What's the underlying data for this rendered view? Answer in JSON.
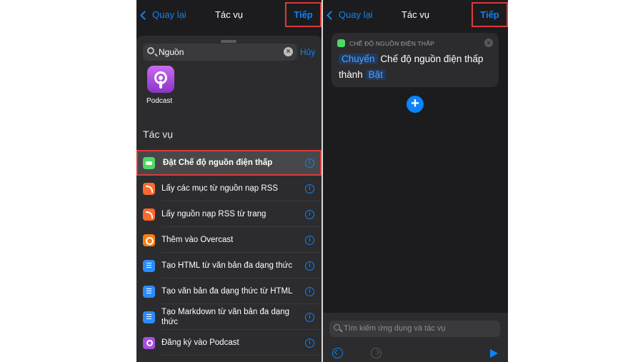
{
  "left": {
    "nav": {
      "back_label": "Quay lại",
      "title": "Tác vụ",
      "next_label": "Tiếp"
    },
    "search": {
      "value": "Nguồn",
      "cancel_label": "Hủy"
    },
    "app": {
      "label": "Podcast",
      "icon": "podcast-icon"
    },
    "section_header": "Tác vụ",
    "actions": [
      {
        "label": "Đặt Chế độ nguồn điện thấp",
        "icon": "battery-icon",
        "color": "#4cd964",
        "selected": true
      },
      {
        "label": "Lấy các mục từ nguồn nạp RSS",
        "icon": "rss-icon",
        "color": "#ff6a2b"
      },
      {
        "label": "Lấy nguồn nạp RSS từ trang",
        "icon": "rss-icon",
        "color": "#ff6a2b"
      },
      {
        "label": "Thêm vào Overcast",
        "icon": "overcast-icon",
        "color": "#fc7e0f"
      },
      {
        "label": "Tạo HTML từ văn bản đa dạng thức",
        "icon": "document-icon",
        "color": "#2a8cff"
      },
      {
        "label": "Tạo văn bản đa dạng thức từ HTML",
        "icon": "document-icon",
        "color": "#2a8cff"
      },
      {
        "label": "Tạo Markdown từ văn bản đa dạng thức",
        "icon": "document-icon",
        "color": "#2a8cff"
      },
      {
        "label": "Đăng ký vào Podcast",
        "icon": "podcast-icon",
        "color": "#a94de0"
      }
    ]
  },
  "right": {
    "nav": {
      "back_label": "Quay lại",
      "title": "Tác vụ",
      "next_label": "Tiếp"
    },
    "card": {
      "header": "CHẾ ĐỘ NGUỒN ĐIỆN THẤP",
      "verb_token": "Chuyển",
      "text": "Chế độ nguồn điện thấp",
      "connector": "thành",
      "value_token": "Bật"
    },
    "bottom": {
      "search_placeholder": "Tìm kiếm ứng dụng và tác vụ"
    }
  },
  "colors": {
    "accent": "#0a84ff",
    "highlight_border": "#d93b3b",
    "background": "#1c1c1e"
  }
}
